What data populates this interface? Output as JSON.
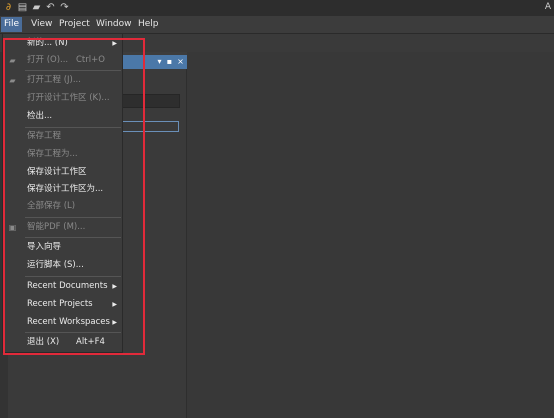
{
  "menubar": {
    "items": [
      "File",
      "View",
      "Project",
      "Window",
      "Help"
    ],
    "right_text": "A"
  },
  "file_menu": {
    "items": [
      {
        "label": "新的... (N)",
        "shortcut": "",
        "submenu": true,
        "enabled": true
      },
      {
        "label": "打开 (O)...",
        "shortcut": "Ctrl+O",
        "submenu": false,
        "enabled": false,
        "icon": "folder-open-icon"
      },
      {
        "label": "打开工程 (J)...",
        "shortcut": "",
        "submenu": false,
        "enabled": false,
        "icon": "open-project-icon"
      },
      {
        "label": "打开设计工作区 (K)...",
        "shortcut": "",
        "submenu": false,
        "enabled": false
      },
      {
        "label": "检出...",
        "shortcut": "",
        "submenu": false,
        "enabled": true
      },
      {
        "label": "保存工程",
        "shortcut": "",
        "submenu": false,
        "enabled": false
      },
      {
        "label": "保存工程为...",
        "shortcut": "",
        "submenu": false,
        "enabled": false
      },
      {
        "label": "保存设计工作区",
        "shortcut": "",
        "submenu": false,
        "enabled": true
      },
      {
        "label": "保存设计工作区为...",
        "shortcut": "",
        "submenu": false,
        "enabled": true
      },
      {
        "label": "全部保存 (L)",
        "shortcut": "",
        "submenu": false,
        "enabled": false
      },
      {
        "label": "智能PDF (M)...",
        "shortcut": "",
        "submenu": false,
        "enabled": false,
        "icon": "pdf-icon"
      },
      {
        "label": "导入向导",
        "shortcut": "",
        "submenu": false,
        "enabled": true
      },
      {
        "label": "运行脚本 (S)...",
        "shortcut": "",
        "submenu": false,
        "enabled": true
      },
      {
        "label": "Recent Documents",
        "shortcut": "",
        "submenu": true,
        "enabled": true
      },
      {
        "label": "Recent Projects",
        "shortcut": "",
        "submenu": true,
        "enabled": true
      },
      {
        "label": "Recent Workspaces",
        "shortcut": "",
        "submenu": true,
        "enabled": true
      },
      {
        "label": "退出 (X)",
        "shortcut": "Alt+F4",
        "submenu": false,
        "enabled": true
      }
    ]
  },
  "colors": {
    "highlight_border": "#e12a3a",
    "menu_active": "#4a6d9a",
    "panel_header": "#4b78a8"
  }
}
